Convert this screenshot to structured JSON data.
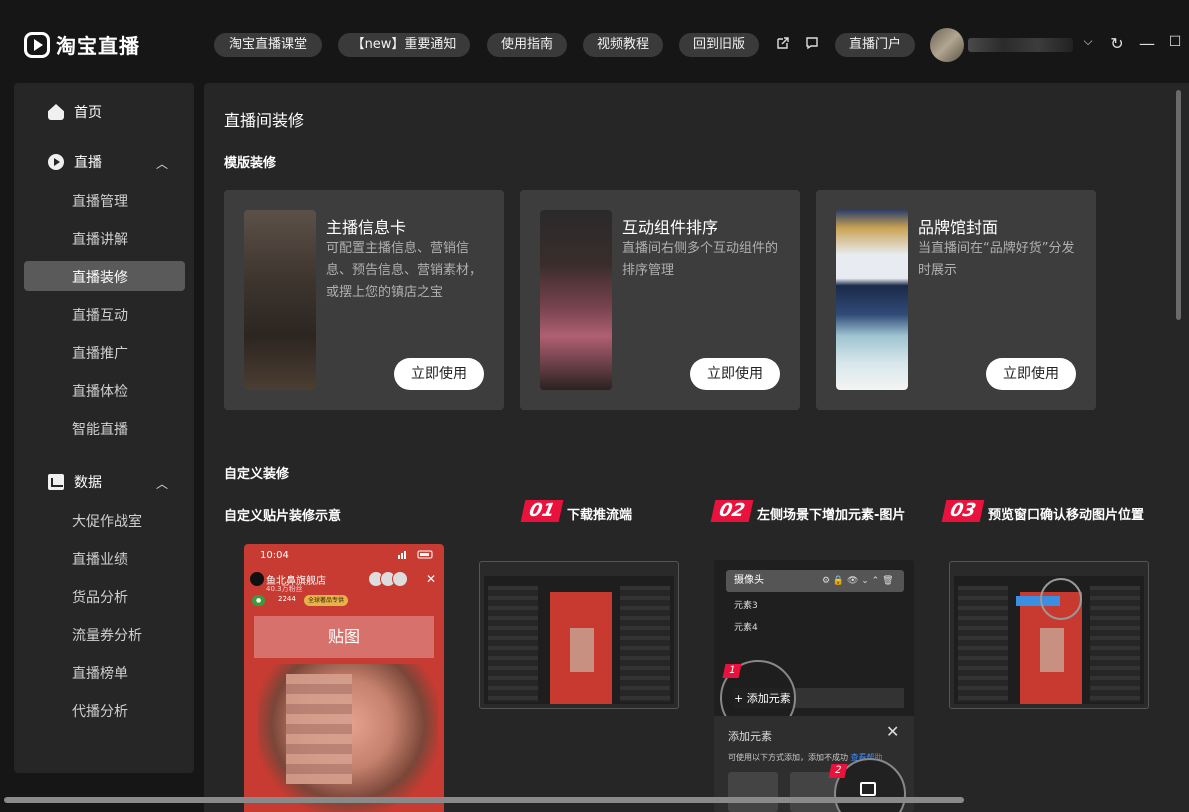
{
  "app": {
    "title": "淘宝直播"
  },
  "header": {
    "nav_pills": [
      "淘宝直播课堂",
      "【new】重要通知",
      "使用指南",
      "视频教程",
      "回到旧版"
    ],
    "portal": "直播门户"
  },
  "sidebar": {
    "home": "首页",
    "live_section": "直播",
    "live_items": [
      "直播管理",
      "直播讲解",
      "直播装修",
      "直播互动",
      "直播推广",
      "直播体检",
      "智能直播"
    ],
    "active_item": "直播装修",
    "data_section": "数据",
    "data_items": [
      "大促作战室",
      "直播业绩",
      "货品分析",
      "流量券分析",
      "直播榜单",
      "代播分析"
    ]
  },
  "main": {
    "title": "直播间装修",
    "template_section": "模版装修",
    "cards": [
      {
        "title": "主播信息卡",
        "desc": "可配置主播信息、营销信息、预告信息、营销素材，或摆上您的镇店之宝",
        "button": "立即使用"
      },
      {
        "title": "互动组件排序",
        "desc": "直播间右侧多个互动组件的排序管理",
        "button": "立即使用"
      },
      {
        "title": "品牌馆封面",
        "desc": "当直播间在“品牌好货”分发时展示",
        "button": "立即使用"
      }
    ],
    "custom_section": "自定义装修",
    "custom_demo_title": "自定义贴片装修示意",
    "steps": [
      {
        "num": "01",
        "label": "下载推流端"
      },
      {
        "num": "02",
        "label": "左侧场景下增加元素-图片"
      },
      {
        "num": "03",
        "label": "预览窗口确认移动图片位置"
      }
    ],
    "phone": {
      "time": "10:04",
      "shop": "鱼北鼻旗舰店",
      "followers": "40.3万粉丝",
      "count": "2244",
      "badge": "全球著品专供",
      "sticker": "贴图"
    },
    "step2_panel": {
      "camera": "摄像头",
      "element3": "元素3",
      "element4": "元素4",
      "add_element": "+ 添加元素",
      "dialog_title": "添加元素",
      "dialog_desc": "可使用以下方式添加，添加不成功",
      "dialog_link": "查看帮助",
      "badge1": "1",
      "badge2": "2"
    }
  }
}
